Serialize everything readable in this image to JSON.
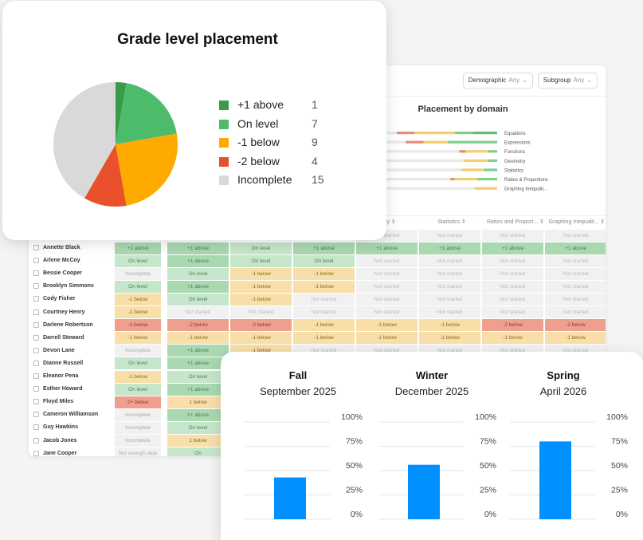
{
  "filters": [
    {
      "label": "Demographic",
      "value": "Any"
    },
    {
      "label": "Subgroup",
      "value": "Any"
    }
  ],
  "domain_chart": {
    "title": "Placement by domain",
    "domains": [
      "Equations",
      "Expressions",
      "Functions",
      "Geometry",
      "Statistics",
      "Ratios & Proportions",
      "Graphing Inequalit..."
    ]
  },
  "table": {
    "headers": [
      "etry",
      "Statistics",
      "Ratios and Proport...",
      "Graphing Inequalit..."
    ],
    "rows": [
      {
        "name": "",
        "cells": [
          "",
          "",
          "",
          "",
          "Not started",
          "Not started",
          "Not started",
          "Not started"
        ]
      },
      {
        "name": "Annette Black",
        "cells": [
          "+1 above",
          "+1 above",
          "On level",
          "+1 above",
          "+1 above",
          "+1 above",
          "+1 above",
          "+1 above"
        ]
      },
      {
        "name": "Arlene McCoy",
        "cells": [
          "On level",
          "+1 above",
          "On level",
          "On level",
          "Not started",
          "Not started",
          "Not started",
          "Not started"
        ]
      },
      {
        "name": "Bessie Cooper",
        "cells": [
          "Incomplete",
          "On level",
          "-1 below",
          "-1 below",
          "Not started",
          "Not started",
          "Not started",
          "Not started"
        ]
      },
      {
        "name": "Brooklyn Simmons",
        "cells": [
          "On level",
          "+1 above",
          "-1 below",
          "-1 below",
          "Not started",
          "Not started",
          "Not started",
          "Not started"
        ]
      },
      {
        "name": "Cody Fisher",
        "cells": [
          "-1 below",
          "On level",
          "-1 below",
          "Not started",
          "Not started",
          "Not started",
          "Not started",
          "Not started"
        ]
      },
      {
        "name": "Courtney Henry",
        "cells": [
          "-1 below",
          "Not started",
          "Not started",
          "Not started",
          "Not started",
          "Not started",
          "Not started",
          "Not started"
        ]
      },
      {
        "name": "Darlene Robertson",
        "cells": [
          "-2 below",
          "-2 below",
          "-2 below",
          "-1 below",
          "-1 below",
          "-1 below",
          "-2 below",
          "-2 below"
        ]
      },
      {
        "name": "Darrell Steward",
        "cells": [
          "-1 below",
          "-1 below",
          "-1 below",
          "-1 below",
          "-1 below",
          "-1 below",
          "-1 below",
          "-1 below"
        ]
      },
      {
        "name": "Devon Lane",
        "cells": [
          "Incomplete",
          "+1 above",
          "-1 below",
          "Not started",
          "Not started",
          "Not started",
          "Not started",
          "Not started"
        ]
      },
      {
        "name": "Dianne Russell",
        "cells": [
          "On level",
          "+1 above",
          "",
          "",
          "",
          "",
          "",
          ""
        ]
      },
      {
        "name": "Eleanor Pena",
        "cells": [
          "-1 below",
          "On level",
          "",
          "",
          "",
          "",
          "",
          ""
        ]
      },
      {
        "name": "Esther Howard",
        "cells": [
          "On level",
          "+1 above",
          "",
          "",
          "",
          "",
          "",
          ""
        ]
      },
      {
        "name": "Floyd Miles",
        "cells": [
          "2+ below",
          "1 below",
          "",
          "",
          "",
          "",
          "",
          ""
        ]
      },
      {
        "name": "Cameron Williamson",
        "cells": [
          "Incomplete",
          "1+ above",
          "",
          "",
          "",
          "",
          "",
          ""
        ]
      },
      {
        "name": "Guy Hawkins",
        "cells": [
          "Incomplete",
          "On level",
          "",
          "",
          "",
          "",
          "",
          ""
        ]
      },
      {
        "name": "Jacob Jones",
        "cells": [
          "Incomplete",
          "1 below",
          "",
          "",
          "",
          "",
          "",
          ""
        ]
      },
      {
        "name": "Jane Cooper",
        "cells": [
          "Not enough data",
          "On",
          "",
          "",
          "",
          "",
          "",
          ""
        ]
      }
    ]
  },
  "pie": {
    "title": "Grade level placement",
    "slices": [
      {
        "label": "+1 above",
        "value": 1,
        "color": "#3a9a48"
      },
      {
        "label": "On level",
        "value": 7,
        "color": "#4cbc6a"
      },
      {
        "label": "-1 below",
        "value": 9,
        "color": "#ffaa00"
      },
      {
        "label": "-2 below",
        "value": 4,
        "color": "#e9502c"
      },
      {
        "label": "Incomplete",
        "value": 15,
        "color": "#d9d9d9"
      }
    ]
  },
  "chart_data": [
    {
      "type": "pie",
      "title": "Grade level placement",
      "categories": [
        "+1 above",
        "On level",
        "-1 below",
        "-2 below",
        "Incomplete"
      ],
      "values": [
        1,
        7,
        9,
        4,
        15
      ]
    },
    {
      "type": "bar",
      "title": "Fall",
      "subtitle": "September 2025",
      "ylim": [
        0,
        100
      ],
      "yticks": [
        "0%",
        "25%",
        "50%",
        "75%",
        "100%"
      ],
      "values": [
        43
      ]
    },
    {
      "type": "bar",
      "title": "Winter",
      "subtitle": "December 2025",
      "ylim": [
        0,
        100
      ],
      "yticks": [
        "0%",
        "25%",
        "50%",
        "75%",
        "100%"
      ],
      "values": [
        56
      ]
    },
    {
      "type": "bar",
      "title": "Spring",
      "subtitle": "April 2026",
      "ylim": [
        0,
        100
      ],
      "yticks": [
        "0%",
        "25%",
        "50%",
        "75%",
        "100%"
      ],
      "values": [
        80
      ]
    }
  ],
  "bar_cards": [
    {
      "season": "Fall",
      "date": "September 2025"
    },
    {
      "season": "Winter",
      "date": "December 2025"
    },
    {
      "season": "Spring",
      "date": "April 2026"
    }
  ],
  "colors": {
    "bar": "#0090ff",
    "above": "#a9d8b1",
    "on_level": "#c6e6cb",
    "below1": "#f8dfa9",
    "below2": "#ee9f8e",
    "neutral": "#f1f1f1"
  }
}
